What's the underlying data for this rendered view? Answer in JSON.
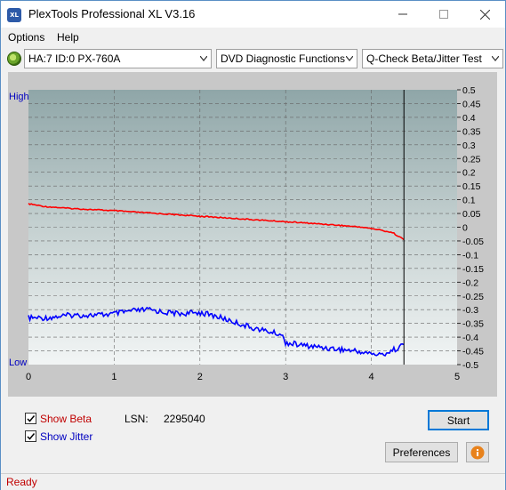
{
  "window": {
    "title": "PlexTools Professional XL V3.16",
    "app_icon_text": "XL",
    "minimize_icon": "minimize-icon",
    "maximize_icon": "maximize-icon",
    "close_icon": "close-icon"
  },
  "menu": {
    "options": "Options",
    "help": "Help"
  },
  "toolbar": {
    "drive": "HA:7 ID:0  PX-760A",
    "function": "DVD Diagnostic Functions",
    "test": "Q-Check Beta/Jitter Test"
  },
  "chart_data": {
    "type": "line",
    "title": "",
    "left_axis_labels": {
      "high": "High",
      "low": "Low"
    },
    "xlim": [
      0,
      5
    ],
    "x_ticks": [
      "0",
      "1",
      "2",
      "3",
      "4",
      "5"
    ],
    "ylim": [
      -0.5,
      0.5
    ],
    "y_ticks": [
      "0.5",
      "0.45",
      "0.4",
      "0.35",
      "0.3",
      "0.25",
      "0.2",
      "0.15",
      "0.1",
      "0.05",
      "0",
      "-0.05",
      "-0.1",
      "-0.15",
      "-0.2",
      "-0.25",
      "-0.3",
      "-0.35",
      "-0.4",
      "-0.45",
      "-0.5"
    ],
    "cursor_x": 4.38,
    "grid": true,
    "series": [
      {
        "color": "#ff0000",
        "x": [
          0,
          0.2,
          0.5,
          1.0,
          1.5,
          2.0,
          2.5,
          3.0,
          3.5,
          3.9,
          4.1,
          4.25,
          4.38
        ],
        "y": [
          0.085,
          0.075,
          0.068,
          0.06,
          0.05,
          0.04,
          0.03,
          0.02,
          0.01,
          0.0,
          -0.01,
          -0.02,
          -0.045
        ]
      },
      {
        "color": "#0000ff",
        "x": [
          0,
          0.2,
          0.5,
          0.8,
          1.0,
          1.2,
          1.4,
          1.6,
          1.8,
          2.0,
          2.2,
          2.4,
          2.6,
          2.8,
          2.95,
          3.0,
          3.2,
          3.5,
          3.8,
          4.0,
          4.1,
          4.2,
          4.3,
          4.38
        ],
        "y": [
          -0.33,
          -0.33,
          -0.32,
          -0.32,
          -0.315,
          -0.305,
          -0.3,
          -0.31,
          -0.315,
          -0.31,
          -0.325,
          -0.345,
          -0.365,
          -0.38,
          -0.39,
          -0.42,
          -0.43,
          -0.44,
          -0.45,
          -0.46,
          -0.465,
          -0.455,
          -0.44,
          -0.425
        ]
      }
    ]
  },
  "options": {
    "show_beta_label": "Show Beta",
    "show_beta_checked": true,
    "show_jitter_label": "Show Jitter",
    "show_jitter_checked": true,
    "lsn_label": "LSN:",
    "lsn_value": "2295040",
    "start_label": "Start",
    "preferences_label": "Preferences",
    "info_icon": "info-icon",
    "beta_color": "#c00000",
    "jitter_color": "#0000c0"
  },
  "status": {
    "text": "Ready"
  }
}
